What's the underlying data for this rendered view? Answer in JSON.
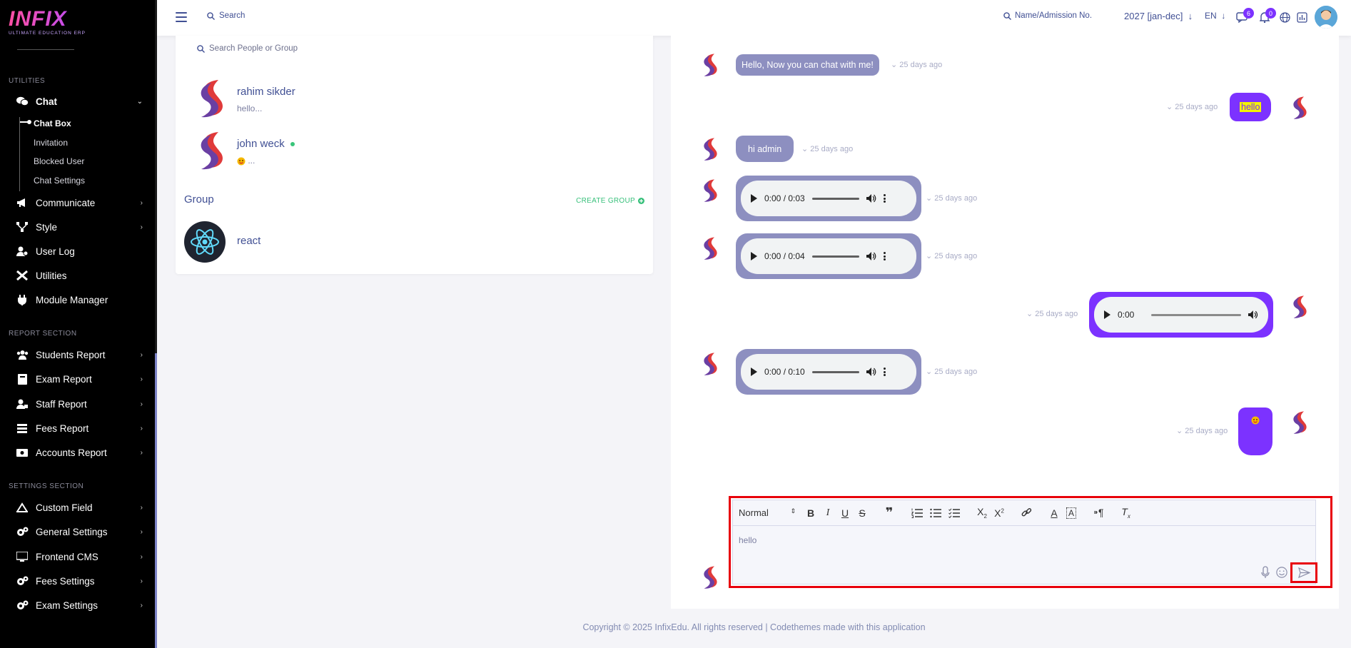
{
  "brand": {
    "name": "INFIX",
    "tagline": "ULTIMATE EDUCATION ERP"
  },
  "sidebar": {
    "sections": [
      {
        "title": "UTILITIES"
      },
      {
        "title": "REPORT SECTION"
      },
      {
        "title": "SETTINGS SECTION"
      }
    ],
    "chat": {
      "label": "Chat",
      "sub": [
        "Chat Box",
        "Invitation",
        "Blocked User",
        "Chat Settings"
      ]
    },
    "items": [
      "Communicate",
      "Style",
      "User Log",
      "Utilities",
      "Module Manager",
      "Students Report",
      "Exam Report",
      "Staff Report",
      "Fees Report",
      "Accounts Report",
      "Custom Field",
      "General Settings",
      "Frontend CMS",
      "Fees Settings",
      "Exam Settings"
    ]
  },
  "topbar": {
    "search_label": "Search",
    "admission_search": "Name/Admission No.",
    "session": "2027 [jan-dec]",
    "language": "EN",
    "chat_badge": "6",
    "notification_badge": "0"
  },
  "list": {
    "search_placeholder": "Search People or Group",
    "contacts": [
      {
        "name": "rahim sikder",
        "last": "hello..."
      },
      {
        "name": "john weck",
        "last": "..."
      }
    ],
    "group_title": "Group",
    "create_group": "CREATE GROUP",
    "groups": [
      {
        "name": "react"
      }
    ]
  },
  "chat": {
    "messages": [
      {
        "text": "Hello, Now you can chat with me!",
        "time": "25 days ago"
      },
      {
        "text": "hello",
        "time": "25 days ago"
      },
      {
        "text": "hi admin",
        "time": "25 days ago"
      },
      {
        "audio": "0:00 / 0:03",
        "time": "25 days ago"
      },
      {
        "audio": "0:00 / 0:04",
        "time": "25 days ago"
      },
      {
        "audio": "0:00",
        "time": "25 days ago"
      },
      {
        "audio": "0:00 / 0:10",
        "time": "25 days ago"
      },
      {
        "time": "25 days ago"
      }
    ]
  },
  "editor": {
    "format": "Normal",
    "text": "hello"
  },
  "footer": "Copyright © 2025 InfixEdu. All rights reserved | Codethemes made with this application",
  "colors": {
    "accent": "#7c32ff",
    "text": "#415094",
    "bubble": "#8d8fc0",
    "highlight": "#e8000b"
  }
}
